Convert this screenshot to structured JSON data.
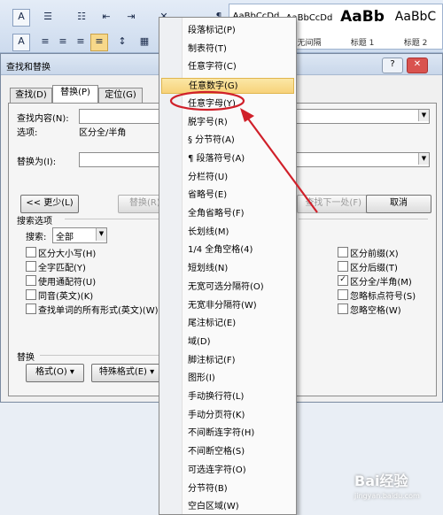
{
  "ribbon": {
    "buttons_row1": [
      "A",
      "☰",
      "☷",
      "⇤",
      "⇥",
      "✕",
      "¶"
    ],
    "buttons_row2": [
      "A",
      "≡",
      "≡",
      "≡",
      "≡",
      "↕",
      "▦",
      "▭"
    ],
    "styles": [
      {
        "preview": "AaBbCcDd",
        "name": ""
      },
      {
        "preview": "AaBbCcDd",
        "name": "无间隔"
      },
      {
        "preview": "AaBb",
        "name": "标题 1"
      },
      {
        "preview": "AaBbC",
        "name": "标题 2"
      }
    ]
  },
  "dialog": {
    "title": "查找和替换",
    "help_label": "?",
    "close_label": "✕",
    "tabs": [
      {
        "label": "查找(D)"
      },
      {
        "label": "替换(P)"
      },
      {
        "label": "定位(G)"
      }
    ],
    "find_label": "查找内容(N):",
    "options_label": "选项:",
    "options_value": "区分全/半角",
    "replace_label": "替换为(I):",
    "less_button": "<< 更少(L)",
    "replace_button": "替换(R)",
    "find_next_button": "查找下一处(F)",
    "cancel_button": "取消",
    "search_options_label": "搜索选项",
    "search_label": "搜索:",
    "search_value": "全部",
    "left_checks": [
      {
        "label": "区分大小写(H)"
      },
      {
        "label": "全字匹配(Y)"
      },
      {
        "label": "使用通配符(U)"
      },
      {
        "label": "同音(英文)(K)"
      },
      {
        "label": "查找单词的所有形式(英文)(W)"
      }
    ],
    "right_checks": [
      {
        "label": "区分前缀(X)"
      },
      {
        "label": "区分后缀(T)"
      },
      {
        "label": "区分全/半角(M)",
        "check": "✓"
      },
      {
        "label": "忽略标点符号(S)"
      },
      {
        "label": "忽略空格(W)"
      }
    ],
    "replace_section_label": "替换",
    "format_button": "格式(O) ▾",
    "special_button": "特殊格式(E) ▾",
    "dropdown_arrow": "▼"
  },
  "menu": {
    "items": [
      {
        "label": "段落标记(P)"
      },
      {
        "label": "制表符(T)"
      },
      {
        "label": "任意字符(C)"
      },
      {
        "label": "任意数字(G)"
      },
      {
        "label": "任意字母(Y)"
      },
      {
        "label": "脱字号(R)"
      },
      {
        "label": "§ 分节符(A)"
      },
      {
        "label": "¶ 段落符号(A)"
      },
      {
        "label": "分栏符(U)"
      },
      {
        "label": "省略号(E)"
      },
      {
        "label": "全角省略号(F)"
      },
      {
        "label": "长划线(M)"
      },
      {
        "label": "1/4 全角空格(4)"
      },
      {
        "label": "短划线(N)"
      },
      {
        "label": "无宽可选分隔符(O)"
      },
      {
        "label": "无宽非分隔符(W)"
      },
      {
        "label": "尾注标记(E)"
      },
      {
        "label": "域(D)"
      },
      {
        "label": "脚注标记(F)"
      },
      {
        "label": "图形(I)"
      },
      {
        "label": "手动换行符(L)"
      },
      {
        "label": "手动分页符(K)"
      },
      {
        "label": "不间断连字符(H)"
      },
      {
        "label": "不间断空格(S)"
      },
      {
        "label": "可选连字符(O)"
      },
      {
        "label": "分节符(B)"
      },
      {
        "label": "空白区域(W)"
      }
    ],
    "highlighted_index": 3,
    "highlight_color": "#f7d27a"
  },
  "annotation": {
    "color": "#d0202a"
  },
  "watermark": {
    "text": "Bai经验",
    "url": "jingyan.baidu.com"
  }
}
